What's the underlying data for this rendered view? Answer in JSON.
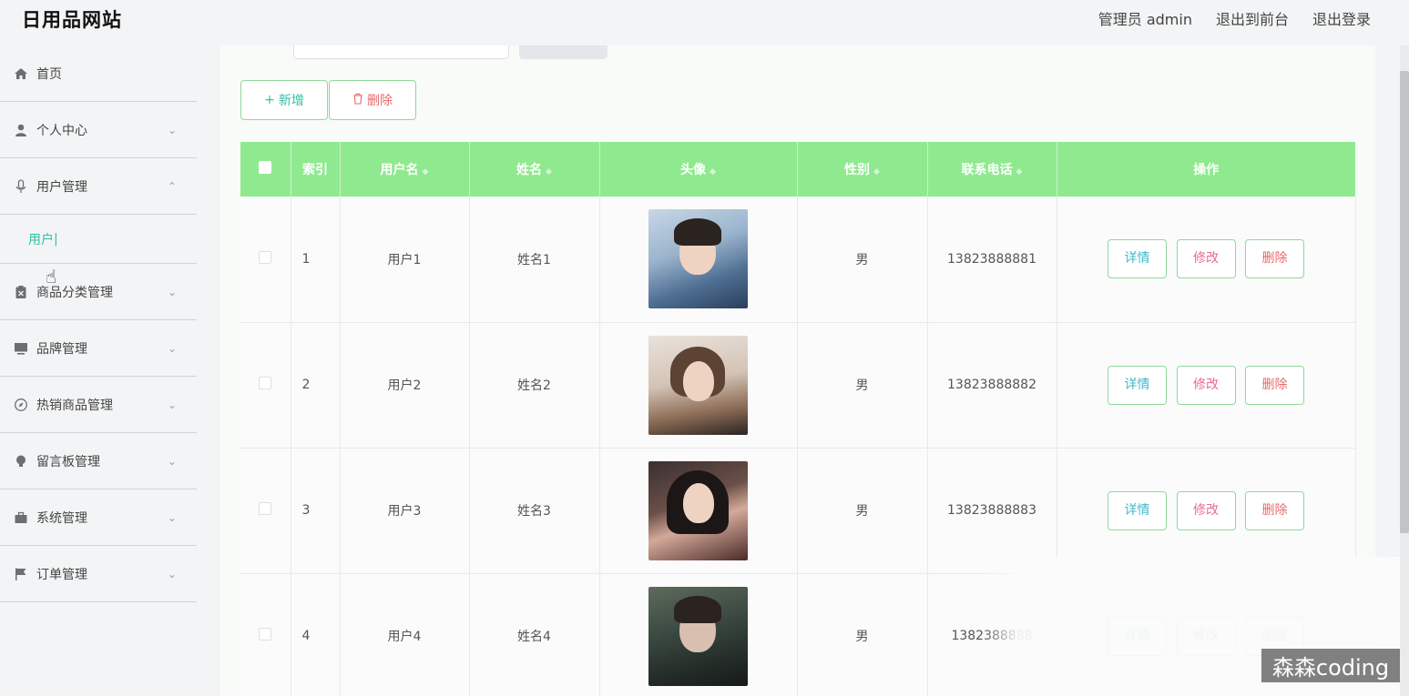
{
  "app": {
    "brand": "日用品网站"
  },
  "header": {
    "admin_label": "管理员 admin",
    "to_front": "退出到前台",
    "logout": "退出登录"
  },
  "sidebar": {
    "items": [
      {
        "label": "首页",
        "icon": "home-icon"
      },
      {
        "label": "个人中心",
        "icon": "person-icon"
      },
      {
        "label": "用户管理",
        "icon": "microphone-icon"
      },
      {
        "label": "商品分类管理",
        "icon": "clipboard-icon"
      },
      {
        "label": "品牌管理",
        "icon": "monitor-icon"
      },
      {
        "label": "热销商品管理",
        "icon": "compass-icon"
      },
      {
        "label": "留言板管理",
        "icon": "bulb-icon"
      },
      {
        "label": "系统管理",
        "icon": "suitcase-icon"
      },
      {
        "label": "订单管理",
        "icon": "flag-icon"
      }
    ],
    "submenu": {
      "label": "用户"
    }
  },
  "toolbar": {
    "add_label": "新增",
    "delete_label": "删除"
  },
  "table": {
    "headers": [
      "索引",
      "用户名",
      "姓名",
      "头像",
      "性别",
      "联系电话",
      "操作"
    ],
    "rows": [
      {
        "index": "1",
        "username": "用户1",
        "name": "姓名1",
        "gender": "男",
        "phone": "13823888881"
      },
      {
        "index": "2",
        "username": "用户2",
        "name": "姓名2",
        "gender": "男",
        "phone": "13823888882"
      },
      {
        "index": "3",
        "username": "用户3",
        "name": "姓名3",
        "gender": "男",
        "phone": "13823888883"
      },
      {
        "index": "4",
        "username": "用户4",
        "name": "姓名4",
        "gender": "男",
        "phone": "1382388888"
      }
    ],
    "actions": {
      "detail": "详情",
      "edit": "修改",
      "delete": "删除"
    }
  },
  "watermark": "森森coding",
  "colors": {
    "header_bg": "#8fea8f",
    "accent": "#2fc1a4",
    "danger": "#e96a6a"
  }
}
